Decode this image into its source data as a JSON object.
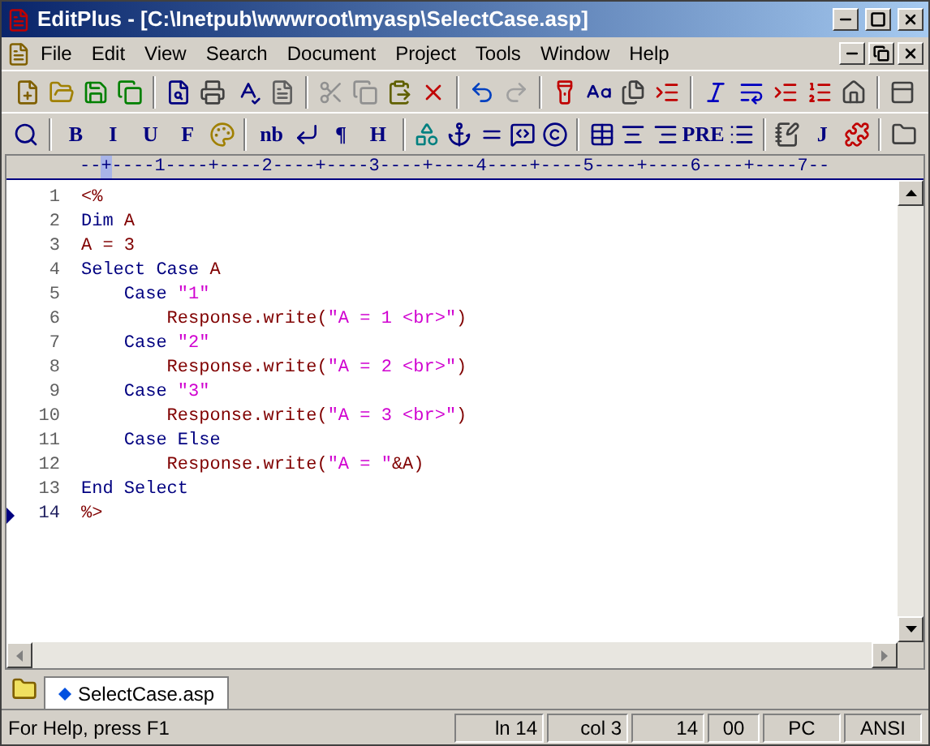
{
  "window": {
    "title": "EditPlus - [C:\\Inetpub\\wwwroot\\myasp\\SelectCase.asp]"
  },
  "menu": [
    "File",
    "Edit",
    "View",
    "Search",
    "Document",
    "Project",
    "Tools",
    "Window",
    "Help"
  ],
  "toolbar_format": [
    {
      "kind": "icon"
    },
    {
      "kind": "separator"
    },
    {
      "kind": "text",
      "label": "B"
    },
    {
      "kind": "text",
      "label": "I"
    },
    {
      "kind": "text",
      "label": "U"
    },
    {
      "kind": "text",
      "label": "F"
    },
    {
      "kind": "icon"
    },
    {
      "kind": "separator"
    },
    {
      "kind": "text",
      "label": "nb"
    },
    {
      "kind": "icon"
    },
    {
      "kind": "text",
      "label": "¶"
    },
    {
      "kind": "text",
      "label": "H"
    },
    {
      "kind": "separator"
    },
    {
      "kind": "icon"
    },
    {
      "kind": "icon"
    },
    {
      "kind": "icon"
    },
    {
      "kind": "icon"
    },
    {
      "kind": "icon"
    },
    {
      "kind": "separator"
    },
    {
      "kind": "icon"
    },
    {
      "kind": "icon"
    },
    {
      "kind": "icon"
    },
    {
      "kind": "text",
      "label": "PRE"
    },
    {
      "kind": "icon"
    },
    {
      "kind": "separator"
    },
    {
      "kind": "icon"
    },
    {
      "kind": "text",
      "label": "J"
    },
    {
      "kind": "icon"
    },
    {
      "kind": "separator"
    },
    {
      "kind": "icon"
    }
  ],
  "ruler": "--+----1----+----2----+----3----+----4----+----5----+----6----+----7--",
  "lines": [
    {
      "number": "1",
      "current": false,
      "tokens": [
        {
          "text": "<%",
          "kind": "delimiter"
        }
      ]
    },
    {
      "number": "2",
      "current": false,
      "tokens": [
        {
          "text": "Dim",
          "kind": "keyword"
        },
        {
          "text": " A",
          "kind": "plain"
        }
      ]
    },
    {
      "number": "3",
      "current": false,
      "tokens": [
        {
          "text": "A = 3",
          "kind": "plain"
        }
      ]
    },
    {
      "number": "4",
      "current": false,
      "tokens": [
        {
          "text": "Select Case",
          "kind": "keyword"
        },
        {
          "text": " A",
          "kind": "plain"
        }
      ]
    },
    {
      "number": "5",
      "current": false,
      "tokens": [
        {
          "text": "    Case",
          "kind": "keyword"
        },
        {
          "text": " \"1\"",
          "kind": "string"
        }
      ]
    },
    {
      "number": "6",
      "current": false,
      "tokens": [
        {
          "text": "        Response.write(",
          "kind": "plain"
        },
        {
          "text": "\"A = 1 <br>\"",
          "kind": "string"
        },
        {
          "text": ")",
          "kind": "plain"
        }
      ]
    },
    {
      "number": "7",
      "current": false,
      "tokens": [
        {
          "text": "    Case",
          "kind": "keyword"
        },
        {
          "text": " \"2\"",
          "kind": "string"
        }
      ]
    },
    {
      "number": "8",
      "current": false,
      "tokens": [
        {
          "text": "        Response.write(",
          "kind": "plain"
        },
        {
          "text": "\"A = 2 <br>\"",
          "kind": "string"
        },
        {
          "text": ")",
          "kind": "plain"
        }
      ]
    },
    {
      "number": "9",
      "current": false,
      "tokens": [
        {
          "text": "    Case",
          "kind": "keyword"
        },
        {
          "text": " \"3\"",
          "kind": "string"
        }
      ]
    },
    {
      "number": "10",
      "current": false,
      "tokens": [
        {
          "text": "        Response.write(",
          "kind": "plain"
        },
        {
          "text": "\"A = 3 <br>\"",
          "kind": "string"
        },
        {
          "text": ")",
          "kind": "plain"
        }
      ]
    },
    {
      "number": "11",
      "current": false,
      "tokens": [
        {
          "text": "    Case Else",
          "kind": "keyword"
        }
      ]
    },
    {
      "number": "12",
      "current": false,
      "tokens": [
        {
          "text": "        Response.write(",
          "kind": "plain"
        },
        {
          "text": "\"A = \"",
          "kind": "string"
        },
        {
          "text": "&A)",
          "kind": "plain"
        }
      ]
    },
    {
      "number": "13",
      "current": false,
      "tokens": [
        {
          "text": "End Select",
          "kind": "keyword"
        }
      ]
    },
    {
      "number": "14",
      "current": true,
      "tokens": [
        {
          "text": "%>",
          "kind": "delimiter"
        }
      ]
    }
  ],
  "tabs": [
    {
      "label": "SelectCase.asp",
      "selected": true
    }
  ],
  "status_bar": {
    "help": "For Help, press F1",
    "panels": [
      "ln 14",
      "col 3",
      "14",
      "00",
      "PC",
      "ANSI"
    ]
  }
}
